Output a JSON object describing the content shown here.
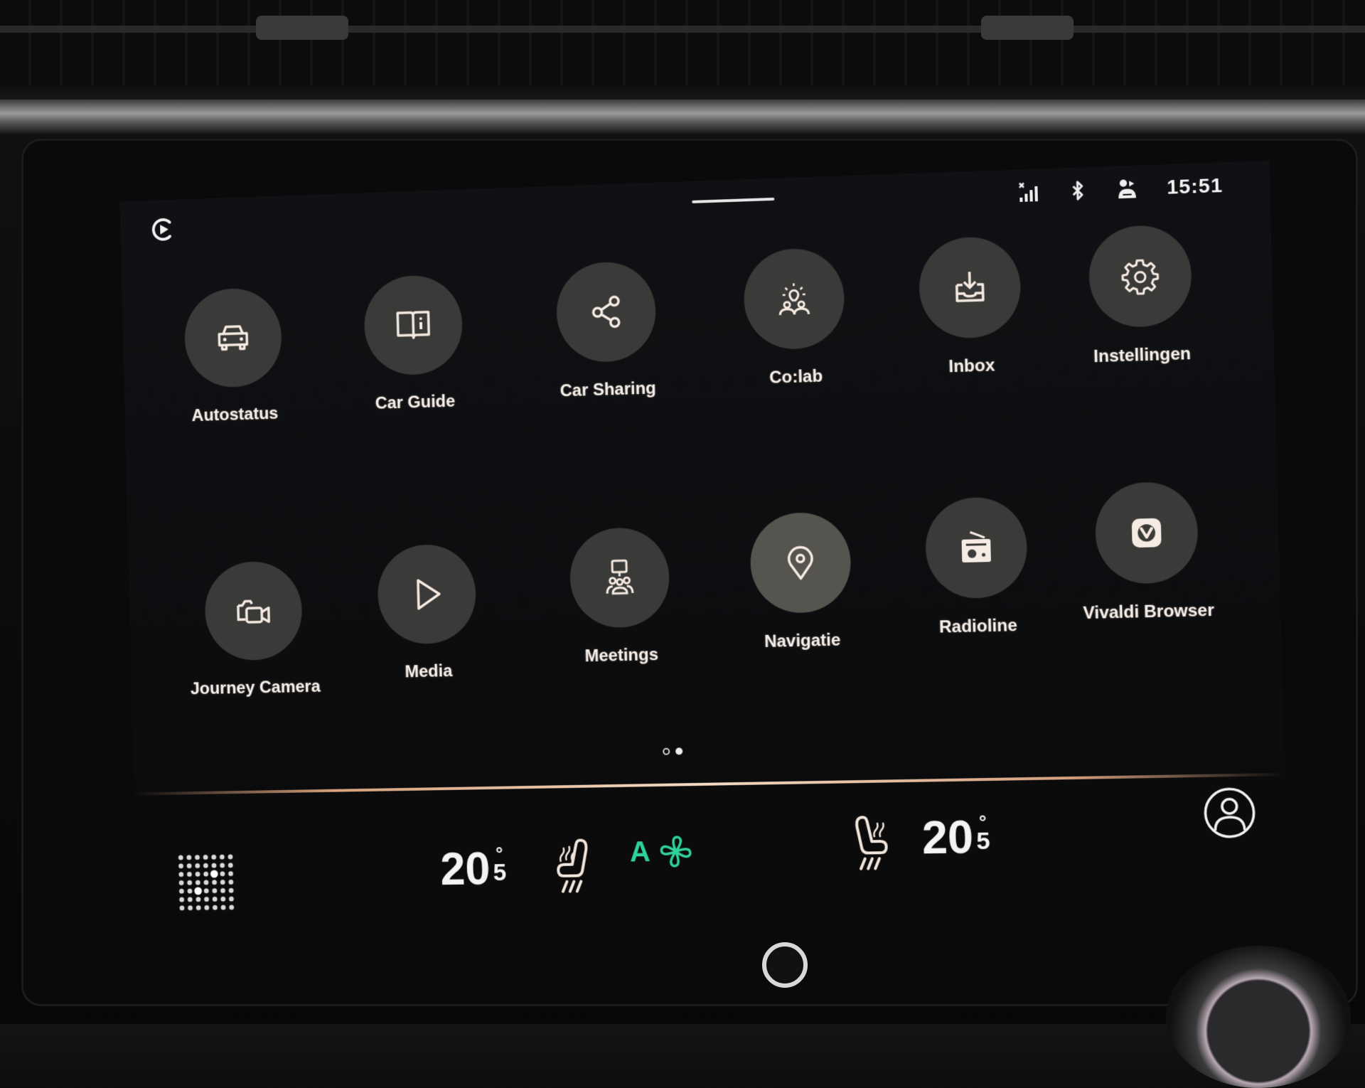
{
  "status_bar": {
    "media_icon": "media-player-icon",
    "icons": [
      "signal-strength-icon",
      "bluetooth-icon",
      "driver-profile-icon"
    ],
    "clock": "15:51"
  },
  "apps": [
    {
      "label": "Autostatus",
      "icon": "car-icon"
    },
    {
      "label": "Car Guide",
      "icon": "book-info-icon"
    },
    {
      "label": "Car Sharing",
      "icon": "share-icon"
    },
    {
      "label": "Co:lab",
      "icon": "lightbulb-people-icon"
    },
    {
      "label": "Inbox",
      "icon": "inbox-download-icon"
    },
    {
      "label": "Instellingen",
      "icon": "gear-icon"
    },
    {
      "label": "Journey Camera",
      "icon": "camera-video-icon"
    },
    {
      "label": "Media",
      "icon": "play-icon"
    },
    {
      "label": "Meetings",
      "icon": "meeting-icon"
    },
    {
      "label": "Navigatie",
      "icon": "location-pin-icon"
    },
    {
      "label": "Radioline",
      "icon": "radio-icon"
    },
    {
      "label": "Vivaldi Browser",
      "icon": "vivaldi-icon"
    }
  ],
  "pagination": {
    "total_pages": 2,
    "current_page": 2
  },
  "climate": {
    "left_temp": {
      "whole": "20",
      "decimal": "5",
      "unit": "°"
    },
    "right_temp": {
      "whole": "20",
      "decimal": "5",
      "unit": "°"
    },
    "fan_mode": "A",
    "accent_color": "#2fd39a"
  }
}
